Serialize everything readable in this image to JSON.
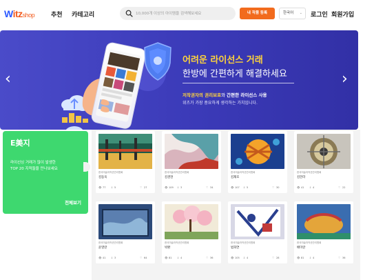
{
  "header": {
    "logo_w": "W",
    "logo_itz": "itz",
    "logo_shop": "shop",
    "nav": [
      "추천",
      "카테고리"
    ],
    "search_placeholder": "10,000개 이상의 아이템을 검색해보세요",
    "register_label": "내 작품 등록",
    "language": "한국어",
    "login": "로그인",
    "signup": "회원가입"
  },
  "banner": {
    "headline": "어려운 라이선스 거래",
    "headline2": "한방에 간편하게 해결하세요",
    "sub1_hl": "저작권자의 권리보호",
    "sub1_mid": "와 ",
    "sub1_b": "간편한 라이선스 사용",
    "sub2": "위츠가 가장 중요하게 생각하는 가치입니다.",
    "prev_icon": "chevron-left-icon",
    "next_icon": "chevron-right-icon"
  },
  "promo": {
    "title": "E美지",
    "desc_line1": "라이선싱 거래가 많이 발생한",
    "desc_line2": "TOP 20 지적들을 만나보세요",
    "more": "전체보기"
  },
  "artworks": [
    {
      "category": "한국미술저작권관리협회",
      "artist": "김동욱",
      "views": "77",
      "downloads": "5",
      "likes": "27"
    },
    {
      "category": "한국미술저작권관리협회",
      "artist": "김경현",
      "views": "109",
      "downloads": "3",
      "likes": "34"
    },
    {
      "category": "한국미술저작권관리협회",
      "artist": "김재호",
      "views": "107",
      "downloads": "5",
      "likes": "30"
    },
    {
      "category": "한국미술저작권관리협회",
      "artist": "김한라",
      "views": "41",
      "downloads": "4",
      "likes": "22"
    },
    {
      "category": "한국미술저작권관리협회",
      "artist": "윤영란",
      "views": "41",
      "downloads": "3",
      "likes": "64"
    },
    {
      "category": "한국미술저작권관리협회",
      "artist": "박환",
      "views": "81",
      "downloads": "4",
      "likes": "36"
    },
    {
      "category": "한국미술저작권관리협회",
      "artist": "범희연",
      "views": "105",
      "downloads": "4",
      "likes": "28"
    },
    {
      "category": "한국미술저작권관리협회",
      "artist": "배미란",
      "views": "81",
      "downloads": "4",
      "likes": "36"
    }
  ],
  "colors": {
    "brand_blue": "#2e5bff",
    "brand_orange": "#f26b1d",
    "banner_bg": "#3b3ab8",
    "banner_accent": "#ffd43b",
    "promo_green": "#3ed86f"
  }
}
